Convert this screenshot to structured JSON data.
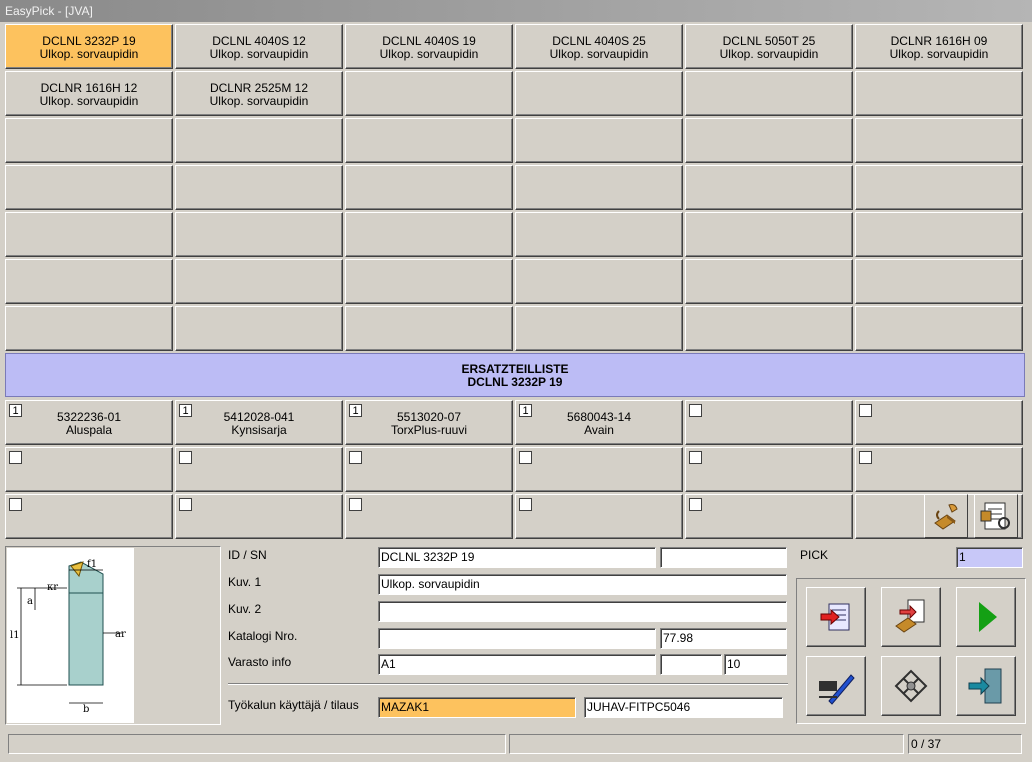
{
  "window": {
    "title": "EasyPick - [JVA]"
  },
  "tools": [
    {
      "code": "DCLNL 3232P 19",
      "desc": "Ulkop. sorvaupidin",
      "selected": true
    },
    {
      "code": "DCLNL 4040S 12",
      "desc": "Ulkop. sorvaupidin"
    },
    {
      "code": "DCLNL 4040S 19",
      "desc": "Ulkop. sorvaupidin"
    },
    {
      "code": "DCLNL 4040S 25",
      "desc": "Ulkop. sorvaupidin"
    },
    {
      "code": "DCLNL 5050T 25",
      "desc": "Ulkop. sorvaupidin"
    },
    {
      "code": "DCLNR 1616H 09",
      "desc": "Ulkop. sorvaupidin"
    },
    {
      "code": "DCLNR 1616H 12",
      "desc": "Ulkop. sorvaupidin"
    },
    {
      "code": "DCLNR 2525M 12",
      "desc": "Ulkop. sorvaupidin"
    }
  ],
  "spare_parts": {
    "title": "ERSATZTEILLISTE",
    "subtitle": "DCLNL 3232P 19",
    "items": [
      {
        "qty": "1",
        "code": "5322236-01",
        "desc": "Aluspala"
      },
      {
        "qty": "1",
        "code": "5412028-041",
        "desc": "Kynsisarja"
      },
      {
        "qty": "1",
        "code": "5513020-07",
        "desc": "TorxPlus-ruuvi"
      },
      {
        "qty": "1",
        "code": "5680043-14",
        "desc": "Avain"
      }
    ]
  },
  "details": {
    "id_label": "ID / SN",
    "id_value": "DCLNL 3232P 19",
    "sn_value": "",
    "kuv1_label": "Kuv. 1",
    "kuv1_value": "Ulkop. sorvaupidin",
    "kuv2_label": "Kuv. 2",
    "kuv2_value": "",
    "katalogi_label": "Katalogi Nro.",
    "katalogi_value": "",
    "price_value": "77.98",
    "varasto_label": "Varasto info",
    "varasto_value": "A1",
    "varasto_mid": "",
    "varasto_qty": "10",
    "user_label": "Työkalun käyttäjä / tilaus",
    "user_value": "MAZAK1",
    "order_value": "JUHAV-FITPC5046"
  },
  "pick": {
    "label": "PICK",
    "value": "1"
  },
  "diagram_labels": {
    "f1": "f1",
    "kr": "κr",
    "l1": "l1",
    "b": "b",
    "a": "a",
    "ar": "ar"
  },
  "status": {
    "left": "",
    "mid": "",
    "counter": "0 /  37"
  },
  "icons": {
    "parts": "wrench-parts-icon",
    "list": "parts-list-icon",
    "export": "export-document-icon",
    "transfer": "transfer-icon",
    "play": "play-icon",
    "edit": "edit-pen-icon",
    "grid": "tool-grid-icon",
    "exit": "exit-door-icon"
  },
  "colors": {
    "selected": "#fdc25e",
    "banner": "#bcbcf5",
    "play": "#14a014"
  }
}
